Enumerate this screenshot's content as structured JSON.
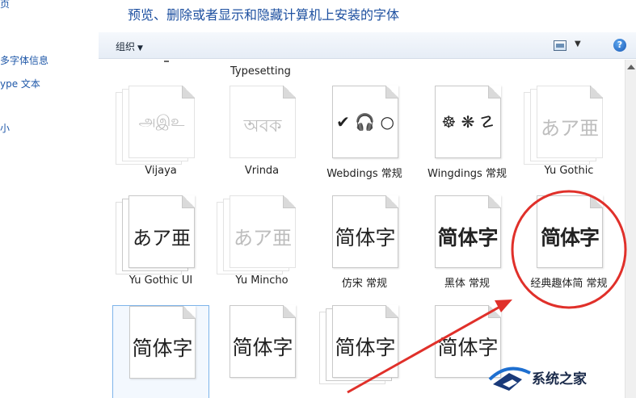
{
  "sidebar": {
    "items": [
      {
        "label": "页"
      },
      {
        "label": "多字体信息"
      },
      {
        "label": "ype 文本"
      },
      {
        "label": "小"
      }
    ]
  },
  "header": {
    "title": "预览、删除或者显示和隐藏计算机上安装的字体"
  },
  "toolbar": {
    "organize_label": "组织",
    "help_label": "?"
  },
  "content": {
    "partial_label": "Typesetting"
  },
  "fonts": [
    {
      "name": "Vijaya",
      "sample": "அஇஉ",
      "faded": true,
      "stacked": true
    },
    {
      "name": "Vrinda",
      "sample": "অবক",
      "faded": true,
      "stacked": false
    },
    {
      "name": "Webdings 常规",
      "sample": "✔ 🎧 ○",
      "faded": false,
      "stacked": false
    },
    {
      "name": "Wingdings 常规",
      "sample": "☸ ❋ ☡",
      "faded": false,
      "stacked": false
    },
    {
      "name": "Yu Gothic",
      "sample": "あア亜",
      "faded": true,
      "stacked": true
    },
    {
      "name": "Yu Gothic UI",
      "sample": "あア亜",
      "faded": false,
      "stacked": true
    },
    {
      "name": "Yu Mincho",
      "sample": "あア亜",
      "faded": true,
      "stacked": true
    },
    {
      "name": "仿宋 常规",
      "sample": "简体字",
      "faded": false,
      "stacked": false
    },
    {
      "name": "黑体 常规",
      "sample": "简体字",
      "faded": false,
      "stacked": false
    },
    {
      "name": "经典趣体简 常规",
      "sample": "简体字",
      "faded": false,
      "stacked": false
    },
    {
      "name": "",
      "sample": "简体字",
      "faded": false,
      "stacked": false
    },
    {
      "name": "",
      "sample": "简体字",
      "faded": false,
      "stacked": false
    },
    {
      "name": "",
      "sample": "简体字",
      "faded": false,
      "stacked": true
    },
    {
      "name": "",
      "sample": "简体字",
      "faded": false,
      "stacked": false
    }
  ],
  "watermark": {
    "text": "系统之家"
  },
  "colors": {
    "link": "#1e57a8",
    "header": "#1e50a0",
    "annotation": "#e0302a",
    "selection": "#7eb4ea"
  }
}
